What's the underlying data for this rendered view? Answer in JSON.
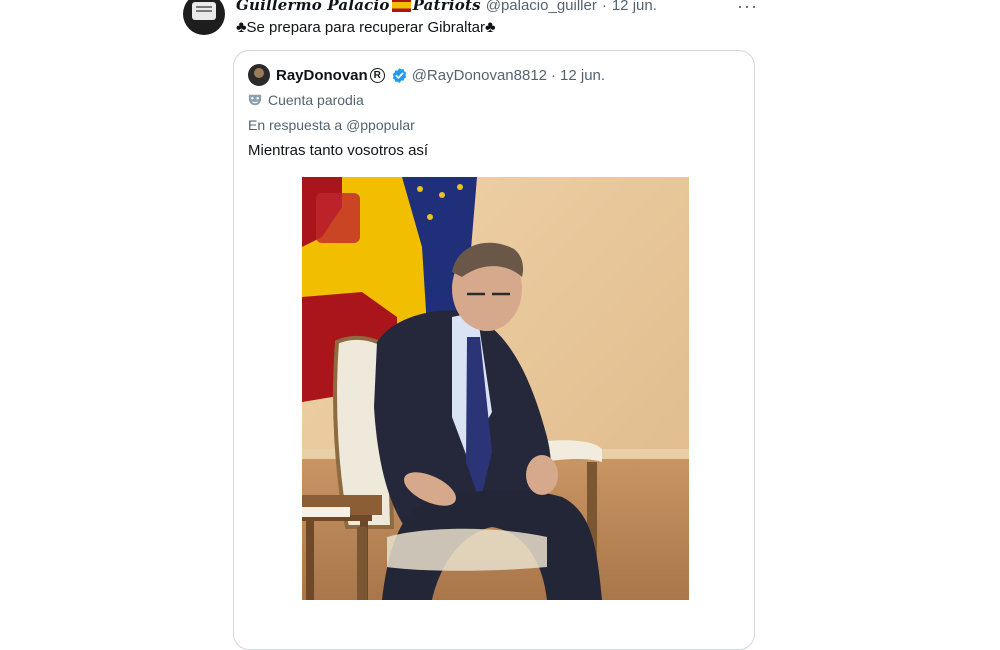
{
  "tweet": {
    "display_name": "Guillermo Palacio",
    "display_name_suffix": "Patriots",
    "handle": "@palacio_guiller",
    "separator": "·",
    "date": "12 jun.",
    "more": "···",
    "text_prefix": "♣",
    "text": "Se prepara para recuperar Gibraltar",
    "text_suffix": "♣"
  },
  "quote": {
    "display_name": "RayDonovan",
    "registered_mark": "R",
    "handle": "@RayDonovan8812",
    "separator": "·",
    "date": "12 jun.",
    "parody_label": "Cuenta parodia",
    "reply_prefix": "En respuesta a ",
    "reply_handle": "@ppopular",
    "text": "Mientras tanto vosotros así"
  },
  "colors": {
    "text_primary": "#0f1419",
    "text_secondary": "#536471",
    "verified_blue": "#1d9bf0",
    "card_border": "#cfd9de",
    "photo_wall": "#e7c79a",
    "spain_red": "#aa151b",
    "spain_yellow": "#f1bf00",
    "eu_blue": "#1f2f7a",
    "suit": "#25283a",
    "tie": "#2a3477"
  },
  "icons": {
    "more": "more-icon",
    "verified": "verified-badge-icon",
    "parody": "parody-mask-icon"
  }
}
